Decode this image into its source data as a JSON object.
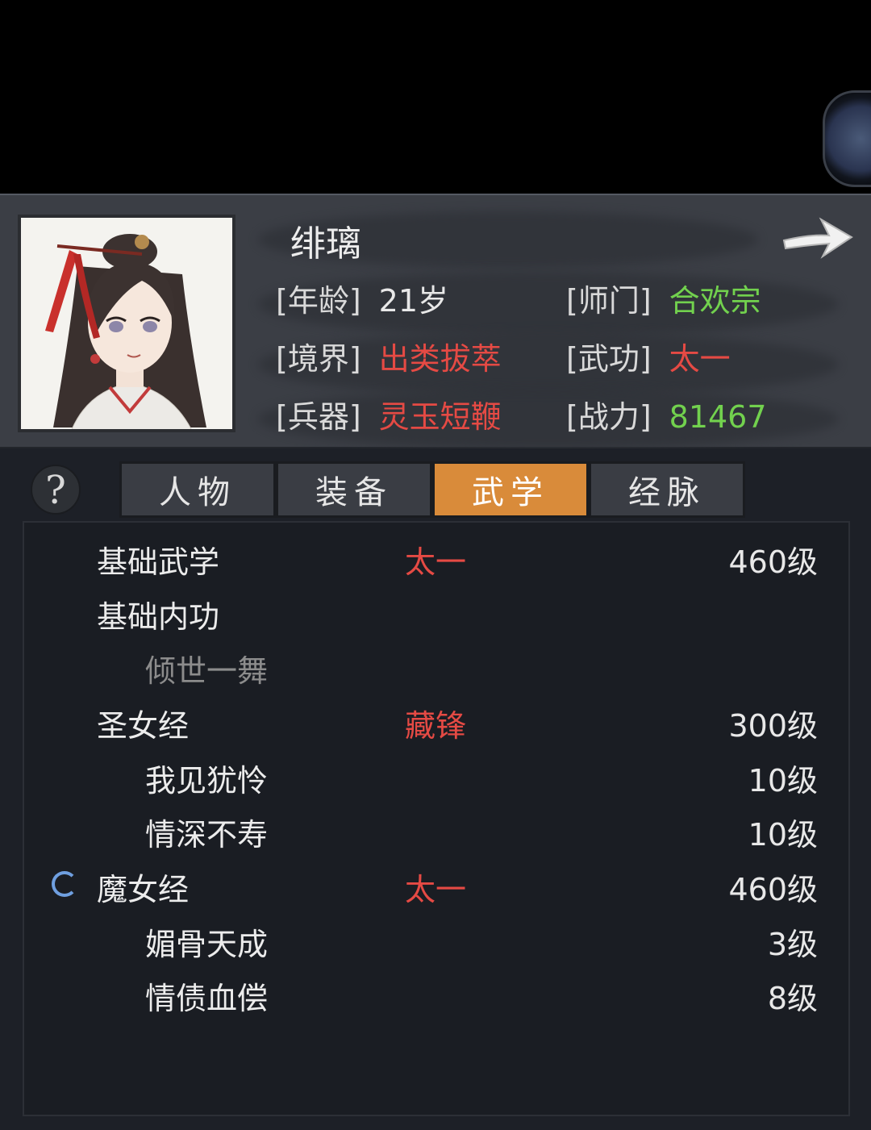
{
  "character": {
    "name": "绯璃",
    "fields": {
      "age": {
        "label": "[年龄]",
        "value": "21岁"
      },
      "sect": {
        "label": "[师门]",
        "value": "合欢宗"
      },
      "realm": {
        "label": "[境界]",
        "value": "出类拔萃"
      },
      "martial": {
        "label": "[武功]",
        "value": "太一"
      },
      "weapon": {
        "label": "[兵器]",
        "value": "灵玉短鞭"
      },
      "power": {
        "label": "[战力]",
        "value": "81467"
      }
    }
  },
  "tabs": [
    {
      "label": "人物",
      "active": false
    },
    {
      "label": "装备",
      "active": false
    },
    {
      "label": "武学",
      "active": true
    },
    {
      "label": "经脉",
      "active": false
    }
  ],
  "help": {
    "label": "?"
  },
  "skills": [
    {
      "name": "基础武学",
      "tier": "太一",
      "level": "460级"
    },
    {
      "name": "基础内功",
      "tier": "",
      "level": ""
    },
    {
      "name": "倾世一舞",
      "tier": "",
      "level": ""
    },
    {
      "name": "圣女经",
      "tier": "藏锋",
      "level": "300级"
    },
    {
      "name": "我见犹怜",
      "tier": "",
      "level": "10级"
    },
    {
      "name": "情深不寿",
      "tier": "",
      "level": "10级"
    },
    {
      "name": "魔女经",
      "tier": "太一",
      "level": "460级"
    },
    {
      "name": "媚骨天成",
      "tier": "",
      "level": "3级"
    },
    {
      "name": "情债血偿",
      "tier": "",
      "level": "8级"
    }
  ],
  "colors": {
    "accent_tab": "#d98b3a",
    "red": "#e54a44",
    "green": "#72d14e",
    "spinner": "#6f9fe0"
  }
}
